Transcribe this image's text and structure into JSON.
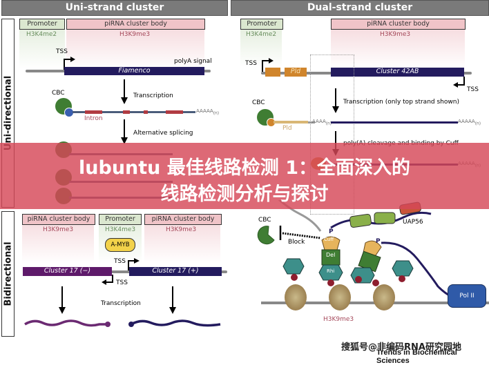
{
  "headers": {
    "uni_strand": "Uni-strand cluster",
    "dual_strand": "Dual-strand cluster"
  },
  "side_labels": {
    "uni": "Uni-directional",
    "bi": "Bidirectional"
  },
  "uni_strand": {
    "promoter": "Promoter",
    "promoter_mark": "H3K4me2",
    "body": "piRNA cluster body",
    "body_mark": "H3K9me3",
    "tss": "TSS",
    "polya_signal": "polyA signal",
    "gene": "Fiamenco",
    "cbc": "CBC",
    "transcription": "Transcription",
    "intron": "Intron",
    "polya_tail": "AAAAA",
    "polya_sub": "(n)",
    "alt_splicing": "Alternative splicing"
  },
  "dual_strand": {
    "promoter": "Promoter",
    "promoter_mark": "H3K4me2",
    "body": "piRNA cluster body",
    "body_mark": "H3K9me3",
    "tss_left": "TSS",
    "tss_right": "TSS",
    "pld": "Pld",
    "gene": "Cluster 42AB",
    "cbc": "CBC",
    "transcription": "Transcription (only top strand shown)",
    "polya_short": "AAAA",
    "polya_tail": "AAAAA",
    "polya_sub": "(n)",
    "cleavage": "poly(A) cleavage and binding by Cuff",
    "uap56": "UAP56",
    "cbc2": "CBC",
    "block": "Block",
    "p": "P",
    "cuff": "Cuff",
    "del": "Del",
    "rhi": "Rhi",
    "pol2": "Pol II",
    "h3k9me3": "H3K9me3"
  },
  "bidirectional": {
    "body_left": "piRNA cluster body",
    "body_left_mark": "H3K9me3",
    "promoter": "Promoter",
    "promoter_mark": "H3K4me3",
    "body_right": "piRNA cluster body",
    "body_right_mark": "H3K9me3",
    "amyb": "A-MYB",
    "tss_top": "TSS",
    "tss_bottom": "TSS",
    "gene_minus": "Cluster 17 (−)",
    "gene_plus": "Cluster 17 (+)",
    "transcription": "Transcription"
  },
  "banner": {
    "line1": "lubuntu 最佳线路检测 1：全面深入的",
    "line2": "线路检测分析与探讨"
  },
  "watermark": "搜狐号@非编码RNA研究园地",
  "source": "Trends in Biochemical Sciences",
  "colors": {
    "banner": "#d64858",
    "navy": "#231b5e",
    "purple": "#5e1a6a",
    "orange": "#d0852c",
    "green": "#3f7d33",
    "teal": "#3d8f8a"
  }
}
